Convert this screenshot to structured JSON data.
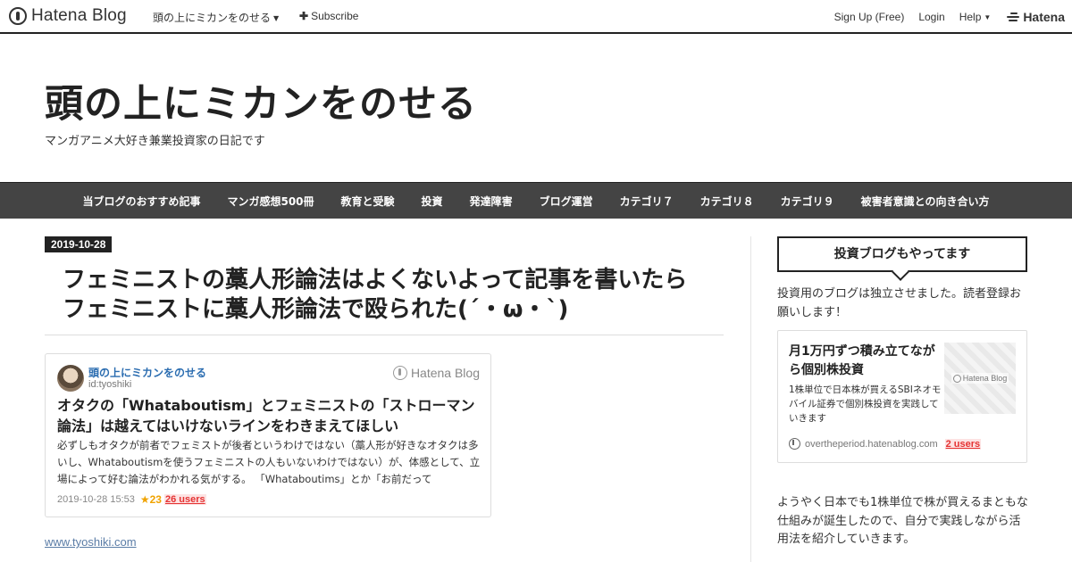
{
  "globalbar": {
    "logo_text": "Hatena Blog",
    "blog_menu_label": "頭の上にミカンをのせる",
    "subscribe_label": "Subscribe",
    "signup_label": "Sign Up (Free)",
    "login_label": "Login",
    "help_label": "Help",
    "hatena_label": "Hatena"
  },
  "header": {
    "title": "頭の上にミカンをのせる",
    "description": "マンガアニメ大好き兼業投資家の日記です"
  },
  "category_nav": [
    "当ブログのおすすめ記事",
    "マンガ感想500冊",
    "教育と受験",
    "投資",
    "発達障害",
    "ブログ運営",
    "カテゴリ７",
    "カテゴリ８",
    "カテゴリ９",
    "被害者意識との向き合い方"
  ],
  "entry": {
    "date": "2019-10-28",
    "title_line1": "フェミニストの藁人形論法はよくないよって記事を書いたら",
    "title_line2": "フェミニストに藁人形論法で殴られた(´・ω・`)",
    "link_text": "www.tyoshiki.com"
  },
  "embed_card": {
    "blog_name": "頭の上にミカンをのせる",
    "user_id": "id:tyoshiki",
    "brand": "Hatena Blog",
    "title": "オタクの「Whataboutism」とフェミニストの「ストローマン論法」は越えてはいけないラインをわきまえてほしい",
    "excerpt": "必ずしもオタクが前者でフェミストが後者というわけではない（藁人形が好きなオタクは多いし、Whataboutismを使うフェミニストの人もいないわけではない）が、体感として、立場によって好む論法がわかれる気がする。 「Whataboutims」とか「お前だって",
    "datetime": "2019-10-28 15:53",
    "star_icon": "★",
    "star_count": "23",
    "users": "26 users"
  },
  "sidebar": {
    "heading": "投資ブログもやってます",
    "intro": "投資用のブログは独立させました。読者登録お願いします！",
    "card": {
      "title": "月1万円ずつ積み立てながら個別株投資",
      "description": "1株単位で日本株が買えるSBIネオモバイル証券で個別株投資を実践していきます",
      "thumb_brand": "Hatena Blog",
      "domain": "overtheperiod.hatenablog.com",
      "users": "2 users"
    },
    "text2": "ようやく日本でも1株単位で株が買えるまともな仕組みが誕生したので、自分で実践しながら活用法を紹介していきます。"
  }
}
